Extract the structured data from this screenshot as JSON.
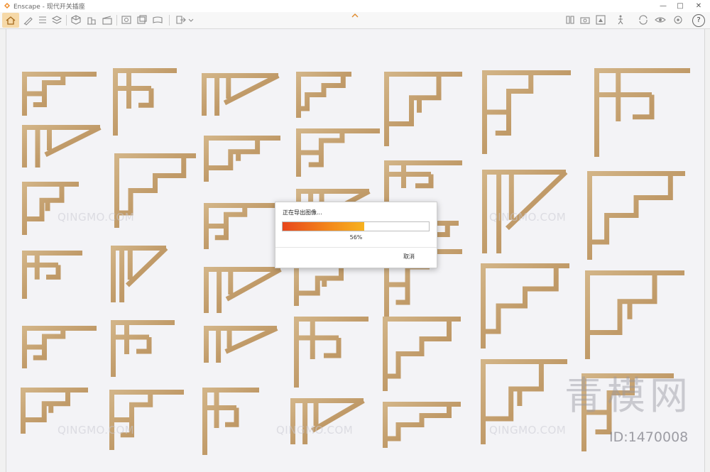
{
  "window": {
    "title": "Enscape - 现代开关插座",
    "minimize": "—",
    "maximize": "□",
    "close": "✕"
  },
  "toolbar": {
    "left_icons": [
      "home-icon",
      "pen-icon",
      "list-icon",
      "layers-icon",
      "cube-icon",
      "building-icon",
      "clapper-icon",
      "screenshot-icon",
      "batch-render-icon",
      "panorama-icon",
      "export-icon"
    ],
    "right_icons": [
      "book-icon",
      "camera-icon",
      "assets-icon",
      "walk-icon",
      "sync-icon",
      "eye-icon",
      "settings-icon",
      "help-icon"
    ],
    "help_label": "?"
  },
  "dialog": {
    "title": "正在导出图像...",
    "progress": 0.56,
    "percent_label": "56%",
    "cancel_label": "取消",
    "colors": {
      "start": "#e8471c",
      "end": "#f7b21f"
    }
  },
  "watermark": {
    "small_text": "QINGMO.COM",
    "big_text": "青模网",
    "id_label": "ID:1470008"
  },
  "scene": {
    "background": "#f3f3f6",
    "material_color": "#c8a877"
  }
}
